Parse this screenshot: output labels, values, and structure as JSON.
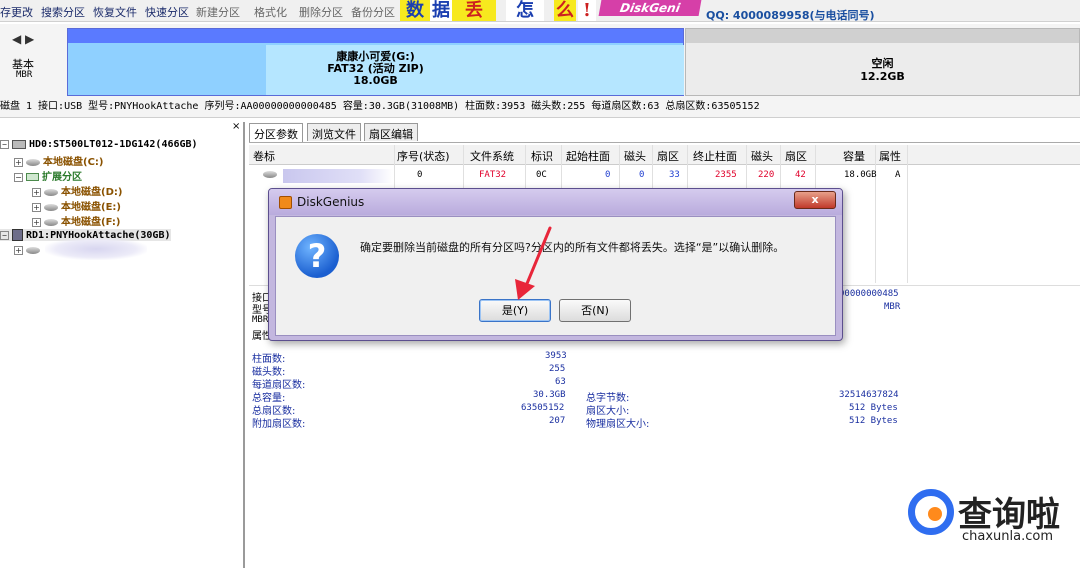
{
  "toolbar": {
    "items": [
      "存更改",
      "搜索分区",
      "恢复文件",
      "快速分区",
      "新建分区",
      "格式化",
      "删除分区",
      "备份分区"
    ],
    "banner": {
      "chars": [
        "数",
        "据",
        "丢",
        "怎",
        "么",
        "!"
      ],
      "brand": "DiskGeni",
      "qq": "QQ: 4000089958(与电话同号)"
    }
  },
  "diskmap": {
    "nav_arrows": "◀ ▶",
    "disk_type": "基本",
    "disk_style": "MBR",
    "partition": {
      "line1": "康康小可爱(G:)",
      "line2": "FAT32 (活动 ZIP)",
      "line3": "18.0GB"
    },
    "free": {
      "line1": "空闲",
      "line2": "12.2GB"
    }
  },
  "infobar": {
    "disk": "磁盘 1",
    "interface": "接口:USB",
    "model": "型号:PNYHookAttache",
    "serial": "序列号:AA00000000000485",
    "capacity": "容量:30.3GB(31008MB)",
    "cylinders": "柱面数:3953",
    "heads": "磁头数:255",
    "sectors_per_track": "每道扇区数:63",
    "total_sectors": "总扇区数:63505152"
  },
  "tree": {
    "close": "×",
    "hd0": "HD0:ST500LT012-1DG142(466GB)",
    "c_drive": "本地磁盘(C:)",
    "extended": "扩展分区",
    "d_drive": "本地磁盘(D:)",
    "e_drive": "本地磁盘(E:)",
    "f_drive": "本地磁盘(F:)",
    "rd1": "RD1:PNYHookAttache(30GB)"
  },
  "tabs": [
    "分区参数",
    "浏览文件",
    "扇区编辑"
  ],
  "table": {
    "headers": [
      "卷标",
      "序号(状态)",
      "文件系统",
      "标识",
      "起始柱面",
      "磁头",
      "扇区",
      "终止柱面",
      "磁头",
      "扇区",
      "容量",
      "属性"
    ],
    "row": [
      "",
      "0",
      "FAT32",
      "0C",
      "0",
      "0",
      "33",
      "2355",
      "220",
      "42",
      "18.0GB",
      "A"
    ]
  },
  "details": {
    "partial_labels": [
      "接口",
      "型号",
      "MBR",
      "属性"
    ],
    "partial_right": [
      "00000000485",
      "MBR"
    ],
    "cylinders_label": "柱面数:",
    "cylinders": "3953",
    "heads_label": "磁头数:",
    "heads": "255",
    "spt_label": "每道扇区数:",
    "spt": "63",
    "capacity_label": "总容量:",
    "capacity": "30.3GB",
    "total_sectors_label": "总扇区数:",
    "total_sectors": "63505152",
    "extra_sectors_label": "附加扇区数:",
    "extra_sectors": "207",
    "total_bytes_label": "总字节数:",
    "total_bytes": "32514637824",
    "sector_size_label": "扇区大小:",
    "sector_size": "512 Bytes",
    "phys_sector_label": "物理扇区大小:",
    "phys_sector": "512 Bytes"
  },
  "dialog": {
    "title": "DiskGenius",
    "close": "x",
    "message": "确定要删除当前磁盘的所有分区吗?分区内的所有文件都将丢失。选择“是”以确认删除。",
    "yes": "是(Y)",
    "no": "否(N)",
    "icon": "?"
  },
  "watermark": {
    "text": "查询啦",
    "url": "chaxunla.com"
  },
  "colors": {
    "partition_top": "#5a7aff",
    "partition_body": "#8fd0ff",
    "dialog_frame": "#c3b7df",
    "red_text": "#e0002a",
    "arrow": "#e8263a"
  }
}
